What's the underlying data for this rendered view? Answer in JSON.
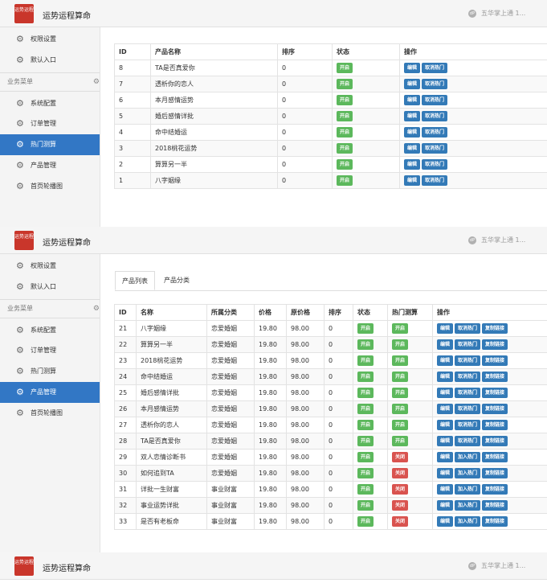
{
  "app": {
    "title": "运势运程算命",
    "logo_text": "运势运程",
    "user": "五华掌上通 1...",
    "user_icon": "dP"
  },
  "sidebar": {
    "top_items": [
      {
        "label": "权限设置",
        "icon": "gear-icon"
      },
      {
        "label": "默认入口",
        "icon": "gear-icon"
      }
    ],
    "section": "业务菜单",
    "items": [
      {
        "label": "系统配置",
        "icon": "gear-icon"
      },
      {
        "label": "订单管理",
        "icon": "gear-icon"
      },
      {
        "label": "热门测算",
        "icon": "gear-icon"
      },
      {
        "label": "产品管理",
        "icon": "gear-icon"
      },
      {
        "label": "首页轮播图",
        "icon": "gear-icon"
      }
    ]
  },
  "hot_table": {
    "headers": [
      "ID",
      "产品名称",
      "排序",
      "状态",
      "操作"
    ],
    "rows": [
      {
        "id": "8",
        "name": "TA是否真爱你",
        "sort": "0",
        "status": "开启",
        "actions": [
          "编辑",
          "取消热门"
        ]
      },
      {
        "id": "7",
        "name": "透析你的恋人",
        "sort": "0",
        "status": "开启",
        "actions": [
          "编辑",
          "取消热门"
        ]
      },
      {
        "id": "6",
        "name": "本月感情运势",
        "sort": "0",
        "status": "开启",
        "actions": [
          "编辑",
          "取消热门"
        ]
      },
      {
        "id": "5",
        "name": "婚后感情详批",
        "sort": "0",
        "status": "开启",
        "actions": [
          "编辑",
          "取消热门"
        ]
      },
      {
        "id": "4",
        "name": "命中结婚运",
        "sort": "0",
        "status": "开启",
        "actions": [
          "编辑",
          "取消热门"
        ]
      },
      {
        "id": "3",
        "name": "2018桃花运势",
        "sort": "0",
        "status": "开启",
        "actions": [
          "编辑",
          "取消热门"
        ]
      },
      {
        "id": "2",
        "name": "算算另一半",
        "sort": "0",
        "status": "开启",
        "actions": [
          "编辑",
          "取消热门"
        ]
      },
      {
        "id": "1",
        "name": "八字姻缘",
        "sort": "0",
        "status": "开启",
        "actions": [
          "编辑",
          "取消热门"
        ]
      }
    ]
  },
  "product_tabs": [
    "产品列表",
    "产品分类"
  ],
  "product_table": {
    "headers": [
      "ID",
      "名称",
      "所属分类",
      "价格",
      "原价格",
      "排序",
      "状态",
      "热门测算",
      "操作"
    ],
    "rows": [
      {
        "id": "21",
        "name": "八字姻缘",
        "category": "恋爱婚姻",
        "price": "19.80",
        "orig": "98.00",
        "sort": "0",
        "status": "开启",
        "hot": "开启",
        "actions": [
          "编辑",
          "取消热门",
          "复制链接"
        ]
      },
      {
        "id": "22",
        "name": "算算另一半",
        "category": "恋爱婚姻",
        "price": "19.80",
        "orig": "98.00",
        "sort": "0",
        "status": "开启",
        "hot": "开启",
        "actions": [
          "编辑",
          "取消热门",
          "复制链接"
        ]
      },
      {
        "id": "23",
        "name": "2018桃花运势",
        "category": "恋爱婚姻",
        "price": "19.80",
        "orig": "98.00",
        "sort": "0",
        "status": "开启",
        "hot": "开启",
        "actions": [
          "编辑",
          "取消热门",
          "复制链接"
        ]
      },
      {
        "id": "24",
        "name": "命中结婚运",
        "category": "恋爱婚姻",
        "price": "19.80",
        "orig": "98.00",
        "sort": "0",
        "status": "开启",
        "hot": "开启",
        "actions": [
          "编辑",
          "取消热门",
          "复制链接"
        ]
      },
      {
        "id": "25",
        "name": "婚后感情详批",
        "category": "恋爱婚姻",
        "price": "19.80",
        "orig": "98.00",
        "sort": "0",
        "status": "开启",
        "hot": "开启",
        "actions": [
          "编辑",
          "取消热门",
          "复制链接"
        ]
      },
      {
        "id": "26",
        "name": "本月感情运势",
        "category": "恋爱婚姻",
        "price": "19.80",
        "orig": "98.00",
        "sort": "0",
        "status": "开启",
        "hot": "开启",
        "actions": [
          "编辑",
          "取消热门",
          "复制链接"
        ]
      },
      {
        "id": "27",
        "name": "透析你的恋人",
        "category": "恋爱婚姻",
        "price": "19.80",
        "orig": "98.00",
        "sort": "0",
        "status": "开启",
        "hot": "开启",
        "actions": [
          "编辑",
          "取消热门",
          "复制链接"
        ]
      },
      {
        "id": "28",
        "name": "TA是否真爱你",
        "category": "恋爱婚姻",
        "price": "19.80",
        "orig": "98.00",
        "sort": "0",
        "status": "开启",
        "hot": "开启",
        "actions": [
          "编辑",
          "取消热门",
          "复制链接"
        ]
      },
      {
        "id": "29",
        "name": "双人恋情诊断书",
        "category": "恋爱婚姻",
        "price": "19.80",
        "orig": "98.00",
        "sort": "0",
        "status": "开启",
        "hot": "关闭",
        "actions": [
          "编辑",
          "加入热门",
          "复制链接"
        ]
      },
      {
        "id": "30",
        "name": "如何追到TA",
        "category": "恋爱婚姻",
        "price": "19.80",
        "orig": "98.00",
        "sort": "0",
        "status": "开启",
        "hot": "关闭",
        "actions": [
          "编辑",
          "加入热门",
          "复制链接"
        ]
      },
      {
        "id": "31",
        "name": "详批一生财富",
        "category": "事业财富",
        "price": "19.80",
        "orig": "98.00",
        "sort": "0",
        "status": "开启",
        "hot": "关闭",
        "actions": [
          "编辑",
          "加入热门",
          "复制链接"
        ]
      },
      {
        "id": "32",
        "name": "事业运势详批",
        "category": "事业财富",
        "price": "19.80",
        "orig": "98.00",
        "sort": "0",
        "status": "开启",
        "hot": "关闭",
        "actions": [
          "编辑",
          "加入热门",
          "复制链接"
        ]
      },
      {
        "id": "33",
        "name": "是否有老板命",
        "category": "事业财富",
        "price": "19.80",
        "orig": "98.00",
        "sort": "0",
        "status": "开启",
        "hot": "关闭",
        "actions": [
          "编辑",
          "加入热门",
          "复制链接"
        ]
      }
    ]
  },
  "colors": {
    "primary": "#3277c5",
    "success": "#5cb85c",
    "danger": "#d9534f",
    "brand": "#c9362b"
  }
}
